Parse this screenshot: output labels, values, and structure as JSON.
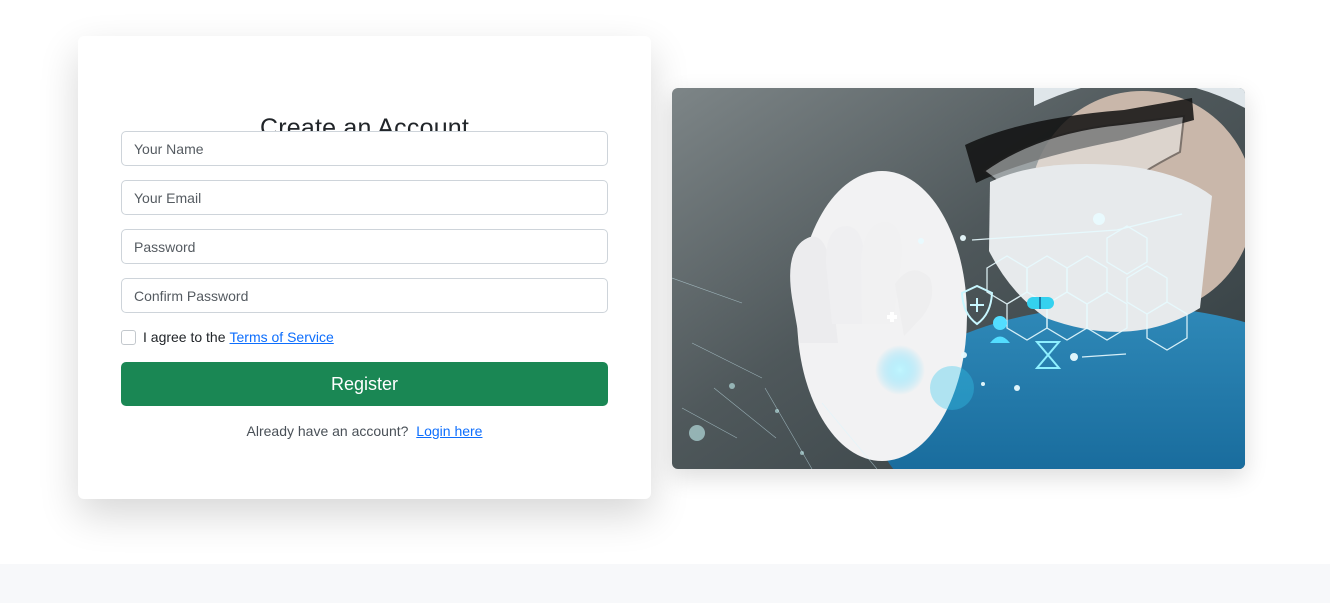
{
  "form": {
    "title": "Create an Account",
    "name_placeholder": "Your Name",
    "email_placeholder": "Your Email",
    "password_placeholder": "Password",
    "confirm_placeholder": "Confirm Password",
    "agree_text": "I agree to the",
    "terms_link": "Terms of Service",
    "register_label": "Register",
    "login_prompt": "Already have an account?",
    "login_link": "Login here"
  },
  "colors": {
    "primary_button": "#1a8754",
    "link": "#0d6efd"
  },
  "hero": {
    "icons": [
      "shield-icon",
      "medical-cross-icon",
      "pill-icon",
      "hourglass-icon",
      "doctor-icon"
    ]
  }
}
